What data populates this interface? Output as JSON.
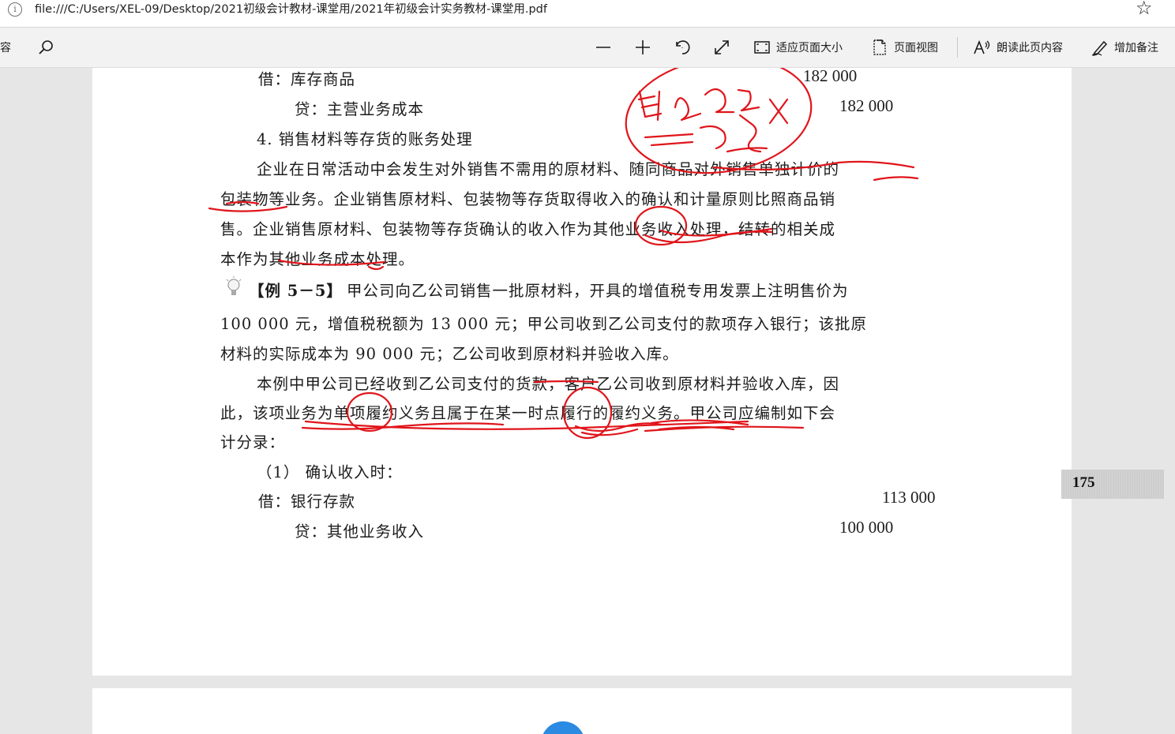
{
  "address_bar": {
    "info_glyph": "i",
    "url": "file:///C:/Users/XEL-09/Desktop/2021初级会计教材-课堂用/2021年初级会计实务教材-课堂用.pdf",
    "favorite_icon": "star-icon"
  },
  "toolbar": {
    "contents_label": "内容",
    "search_icon": "search-icon",
    "zoom_out_icon": "minus-icon",
    "zoom_in_icon": "plus-icon",
    "rotate_icon": "rotate-icon",
    "fullscreen_icon": "expand-icon",
    "fit_page_label": "适应页面大小",
    "page_view_label": "页面视图",
    "read_aloud_label": "朗读此页内容",
    "add_notes_label": "增加备注"
  },
  "document": {
    "page_number": "175",
    "lines": {
      "l1_debit": "借：库存商品",
      "l1_amount": "182 000",
      "l2_credit": "贷：主营业务成本",
      "l2_amount": "182 000",
      "l3_heading": "4. 销售材料等存货的账务处理",
      "p1_line1": "企业在日常活动中会发生对外销售不需用的原材料、随同商品对外销售单独计价的",
      "p1_line2": "包装物等业务。企业销售原材料、包装物等存货取得收入的确认和计量原则比照商品销",
      "p1_line3": "售。企业销售原材料、包装物等存货确认的收入作为其他业务收入处理，结转的相关成",
      "p1_line4": "本作为其他业务成本处理。",
      "example_label": "【例 5－5】",
      "ex_line1": "甲公司向乙公司销售一批原材料，开具的增值税专用发票上注明售价为",
      "ex_line2": "100 000 元，增值税税额为 13 000 元；甲公司收到乙公司支付的款项存入银行；该批原",
      "ex_line3": "材料的实际成本为 90 000 元；乙公司收到原材料并验收入库。",
      "p2_line1": "本例中甲公司已经收到乙公司支付的货款，客户乙公司收到原材料并验收入库，因",
      "p2_line2": "此，该项业务为单项履约义务且属于在某一时点履行的履约义务。甲公司应编制如下会",
      "p2_line3": "计分录：",
      "step1": "（1） 确认收入时：",
      "j1_debit": "借：银行存款",
      "j1_amount": "113 000",
      "j2_credit": "贷：其他业务收入",
      "j2_amount": "100 000"
    }
  }
}
